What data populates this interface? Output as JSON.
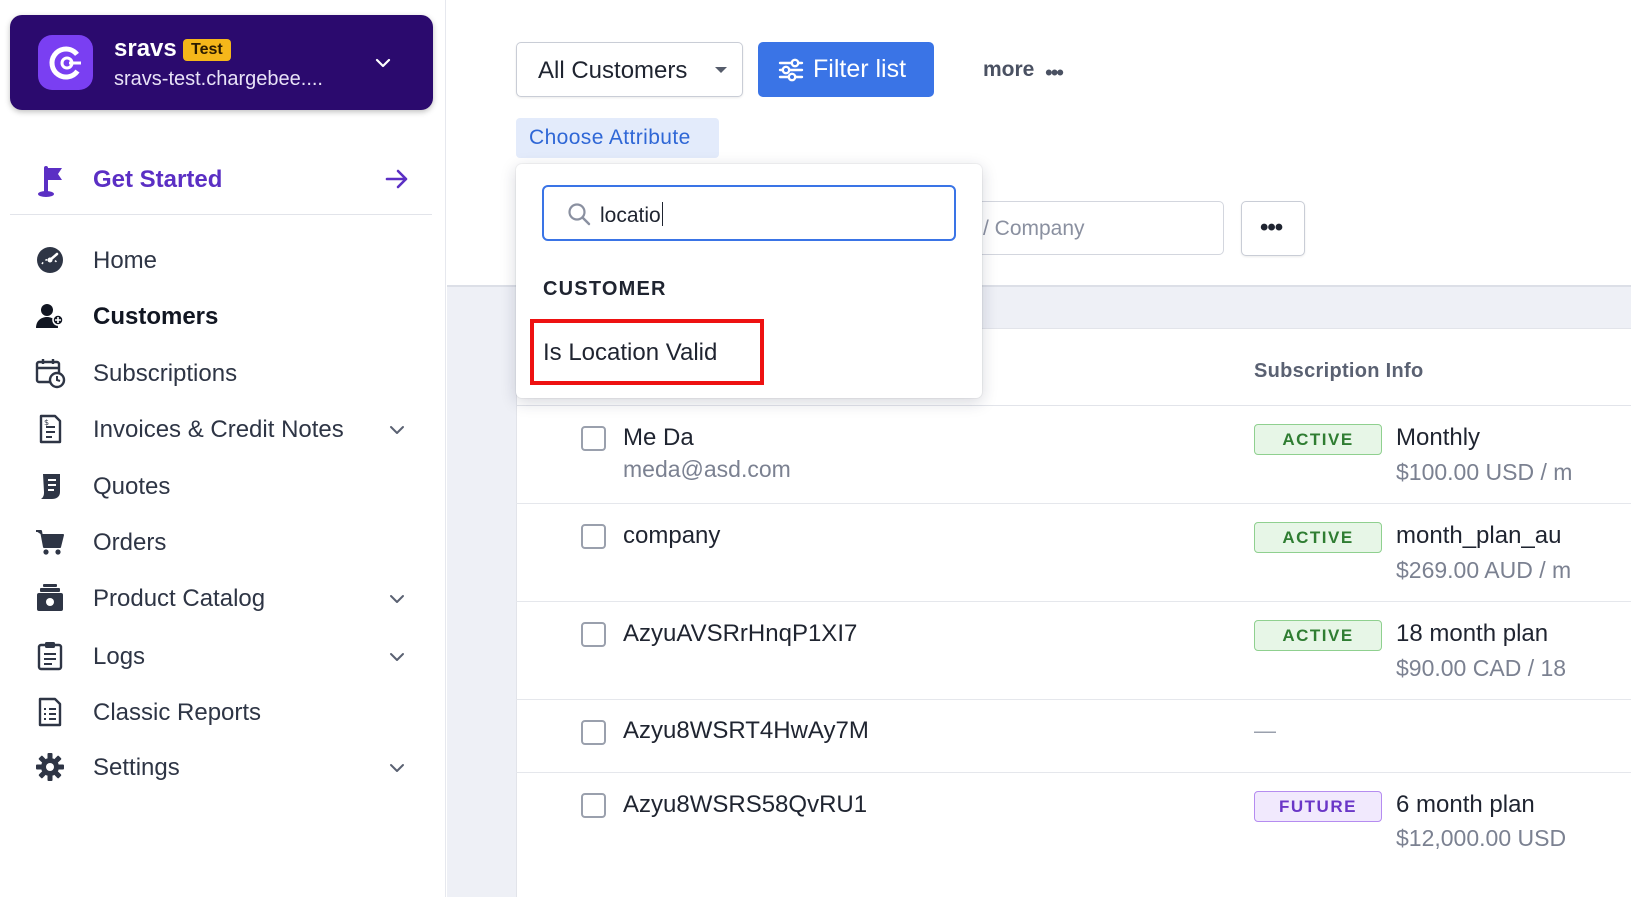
{
  "colors": {
    "site_card_bg": "#2b0a6e",
    "brand_purple": "#7a3ff2",
    "primary_blue": "#3a74e6",
    "highlight_red": "#ee1111",
    "active_green": "#2f7d32",
    "future_purple": "#6a36c7"
  },
  "site": {
    "name": "sravs",
    "badge": "Test",
    "domain": "sravs-test.chargebee....",
    "logo_icon": "chargebee-logo-icon",
    "switch_icon": "chevron-down-icon"
  },
  "sidebar": {
    "get_started": {
      "label": "Get Started",
      "icon": "flag-icon",
      "arrow_icon": "arrow-right-icon"
    },
    "items": [
      {
        "label": "Home",
        "icon": "dashboard-gauge-icon",
        "expandable": false,
        "active": false
      },
      {
        "label": "Customers",
        "icon": "users-icon",
        "expandable": false,
        "active": true
      },
      {
        "label": "Subscriptions",
        "icon": "calendar-clock-icon",
        "expandable": false,
        "active": false
      },
      {
        "label": "Invoices & Credit Notes",
        "icon": "invoice-icon",
        "expandable": true,
        "active": false
      },
      {
        "label": "Quotes",
        "icon": "quote-scroll-icon",
        "expandable": false,
        "active": false
      },
      {
        "label": "Orders",
        "icon": "cart-icon",
        "expandable": false,
        "active": false
      },
      {
        "label": "Product Catalog",
        "icon": "catalog-box-icon",
        "expandable": true,
        "active": false
      },
      {
        "label": "Logs",
        "icon": "clipboard-icon",
        "expandable": true,
        "active": false
      },
      {
        "label": "Classic Reports",
        "icon": "report-icon",
        "expandable": false,
        "active": false
      },
      {
        "label": "Settings",
        "icon": "gear-icon",
        "expandable": true,
        "active": false
      }
    ]
  },
  "toolbar": {
    "view_select": "All Customers",
    "filter_button": "Filter list",
    "more_label": "more",
    "choose_attribute": "Choose Attribute",
    "search_placeholder": "/ Company"
  },
  "attribute_dropdown": {
    "search_value": "locatio",
    "section_heading": "CUSTOMER",
    "options": [
      "Is Location Valid"
    ],
    "highlighted_option": "Is Location Valid"
  },
  "table": {
    "column_subscription_info": "Subscription Info",
    "rows": [
      {
        "name": "Me Da",
        "email": "meda@asd.com",
        "status": "ACTIVE",
        "plan": "Monthly",
        "price": "$100.00 USD / m"
      },
      {
        "name": "company",
        "email": "",
        "status": "ACTIVE",
        "plan": "month_plan_au",
        "price": "$269.00 AUD / m"
      },
      {
        "name": "AzyuAVSRrHnqP1XI7",
        "email": "",
        "status": "ACTIVE",
        "plan": "18 month plan",
        "price": "$90.00 CAD / 18"
      },
      {
        "name": "Azyu8WSRT4HwAy7M",
        "email": "",
        "status": "",
        "plan": "",
        "price": "",
        "empty_marker": "—"
      },
      {
        "name": "Azyu8WSRS58QvRU1",
        "email": "",
        "status": "FUTURE",
        "plan": "6 month plan",
        "price": "$12,000.00 USD"
      }
    ]
  }
}
